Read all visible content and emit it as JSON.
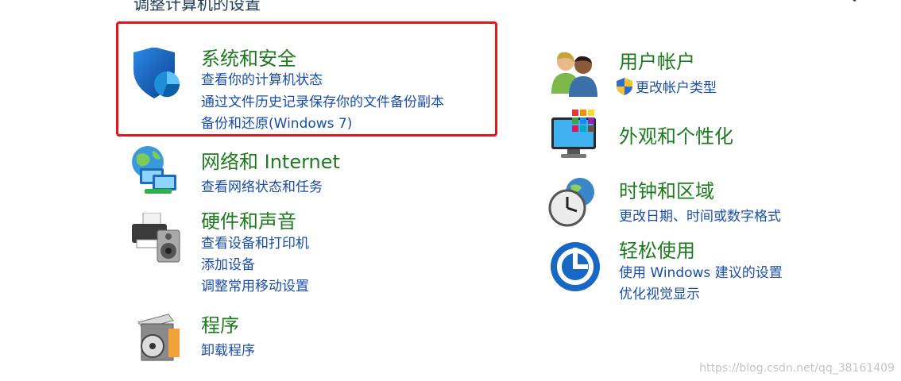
{
  "header": {
    "title": "调整计算机的设置",
    "chevron": "⌄"
  },
  "left_categories": [
    {
      "title": "系统和安全",
      "icon": "security-shield-icon",
      "links": [
        "查看你的计算机状态",
        "通过文件历史记录保存你的文件备份副本",
        "备份和还原(Windows 7)"
      ]
    },
    {
      "title": "网络和 Internet",
      "icon": "network-globe-icon",
      "links": [
        "查看网络状态和任务"
      ]
    },
    {
      "title": "硬件和声音",
      "icon": "printer-speaker-icon",
      "links": [
        "查看设备和打印机",
        "添加设备",
        "调整常用移动设置"
      ]
    },
    {
      "title": "程序",
      "icon": "programs-disc-icon",
      "links": [
        "卸载程序"
      ]
    }
  ],
  "right_categories": [
    {
      "title": "用户帐户",
      "icon": "users-icon",
      "links": [
        "更改帐户类型"
      ]
    },
    {
      "title": "外观和个性化",
      "icon": "monitor-palette-icon",
      "links": []
    },
    {
      "title": "时钟和区域",
      "icon": "clock-globe-icon",
      "links": [
        "更改日期、时间或数字格式"
      ]
    },
    {
      "title": "轻松使用",
      "icon": "ease-of-access-icon",
      "links": [
        "使用 Windows 建议的设置",
        "优化视觉显示"
      ]
    }
  ],
  "watermark": "https://blog.csdn.net/qq_38161409",
  "colors": {
    "title_green": "#1e7a1e",
    "link_blue": "#1a4dab",
    "highlight_red": "#e8141b"
  }
}
